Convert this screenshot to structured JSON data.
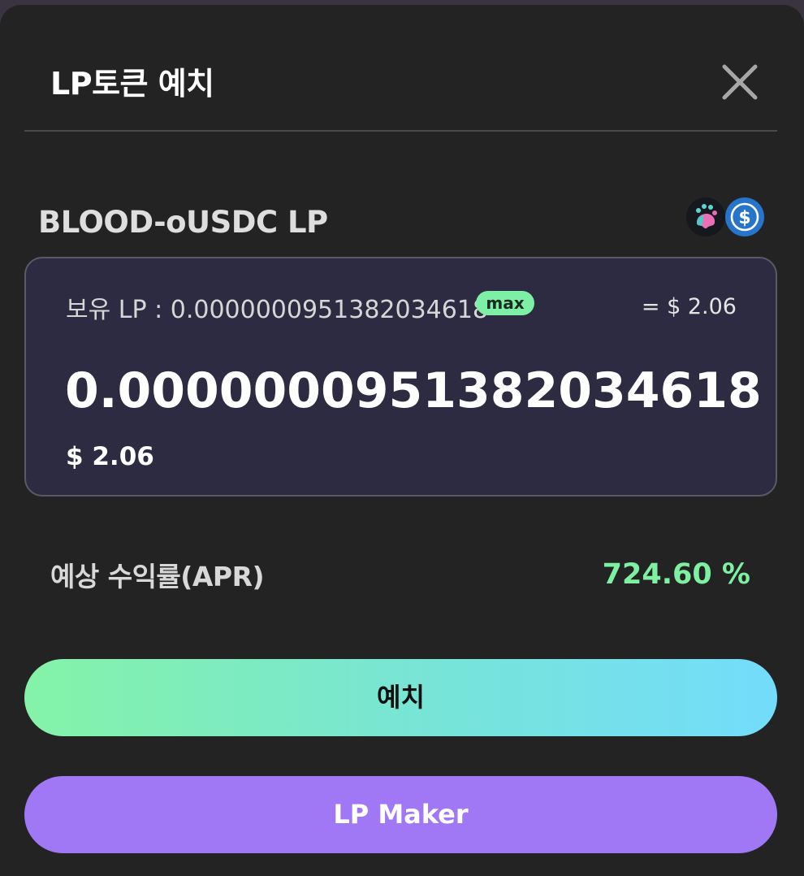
{
  "modal": {
    "title": "LP토큰 예치",
    "close_icon": "close-icon"
  },
  "pair": {
    "name": "BLOOD-oUSDC LP",
    "icons": [
      "blood-token-icon",
      "usdc-token-icon"
    ]
  },
  "input": {
    "balance_label": "보유 LP : ",
    "balance_value": "0.0000000951382034618",
    "max_label": "max",
    "usd_approx": "= $ 2.06",
    "amount": "0.0000000951382034618",
    "amount_usd": "$ 2.06"
  },
  "apr": {
    "label": "예상 수익률(APR)",
    "value": "724.60 %"
  },
  "actions": {
    "deposit_label": "예치",
    "lp_maker_label": "LP Maker"
  },
  "colors": {
    "accent_green": "#7df0a2",
    "accent_purple": "#a077f5",
    "gradient_end": "#73dcfb",
    "panel": "#2c2b42"
  }
}
